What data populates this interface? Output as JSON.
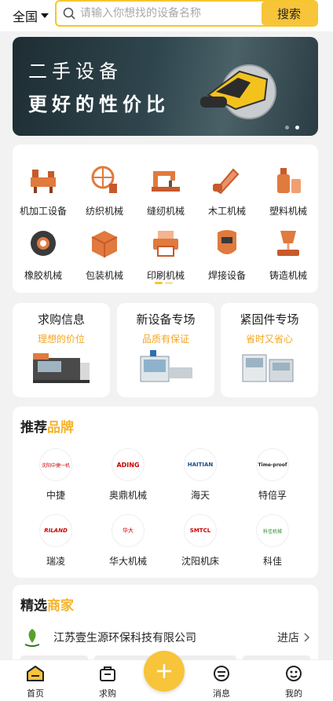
{
  "header": {
    "region": "全国",
    "search_placeholder": "请输入你想找的设备名称",
    "search_button": "搜索"
  },
  "banner": {
    "line1": "二手设备",
    "line2": "更好的性价比"
  },
  "categories": [
    {
      "label": "机加工设备",
      "icon": "lathe-icon"
    },
    {
      "label": "纺织机械",
      "icon": "textile-wheel-icon"
    },
    {
      "label": "缝纫机械",
      "icon": "sewing-machine-icon"
    },
    {
      "label": "木工机械",
      "icon": "chainsaw-icon"
    },
    {
      "label": "塑料机械",
      "icon": "plastic-bottle-icon"
    },
    {
      "label": "橡胶机械",
      "icon": "rubber-tire-icon"
    },
    {
      "label": "包装机械",
      "icon": "package-box-icon"
    },
    {
      "label": "印刷机械",
      "icon": "printer-icon"
    },
    {
      "label": "焊接设备",
      "icon": "welding-mask-icon"
    },
    {
      "label": "铸造机械",
      "icon": "casting-ladle-icon"
    }
  ],
  "promos": [
    {
      "title": "求购信息",
      "subtitle": "理想的价位"
    },
    {
      "title": "新设备专场",
      "subtitle": "品质有保证"
    },
    {
      "title": "紧固件专场",
      "subtitle": "省时又省心"
    }
  ],
  "brands_section": {
    "title_a": "推荐",
    "title_b": "品牌",
    "items": [
      {
        "name": "中捷",
        "logo_text": "沈阳中捷一机"
      },
      {
        "name": "奥鼎机械",
        "logo_text": "ADING"
      },
      {
        "name": "海天",
        "logo_text": "HAITIAN"
      },
      {
        "name": "特倍孚",
        "logo_text": "Time-proof"
      },
      {
        "name": "瑞凌",
        "logo_text": "RILAND"
      },
      {
        "name": "华大机械",
        "logo_text": "华大"
      },
      {
        "name": "沈阳机床",
        "logo_text": "SMTCL"
      },
      {
        "name": "科佳",
        "logo_text": "科佳机械"
      }
    ]
  },
  "merchants_section": {
    "title_a": "精选",
    "title_b": "商家",
    "merchant_name": "江苏壹生源环保科技有限公司",
    "enter_label": "进店"
  },
  "nav": {
    "home": "首页",
    "buy": "求购",
    "message": "消息",
    "mine": "我的"
  },
  "colors": {
    "accent": "#f5c72b",
    "accent_text": "#f5a623"
  }
}
